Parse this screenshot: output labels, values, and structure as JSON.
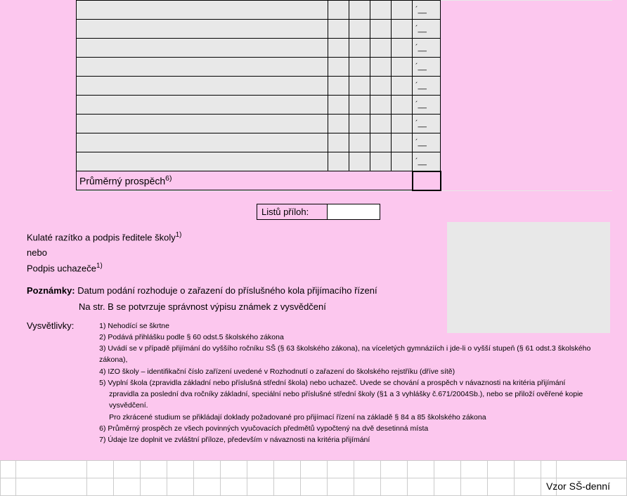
{
  "grades": {
    "placeholder": "´__",
    "row_count": 9,
    "average_label": "Průměrný prospěch",
    "average_sup": "6)"
  },
  "attachments": {
    "label": "Listů příloh:",
    "value": ""
  },
  "stamp": {
    "line1": "Kulaté razítko a podpis ředitele školy",
    "line1_sup": "1)",
    "line2": "nebo",
    "line3": "Podpis uchazeče",
    "line3_sup": "1)"
  },
  "notes": {
    "label": "Poznámky:",
    "text1": "Datum podání rozhoduje o zařazení do příslušného kola přijímacího řízení",
    "text2": "Na str. B se potvrzuje správnost výpisu známek z vysvědčení"
  },
  "explan": {
    "label": "Vysvětlivky:",
    "items": [
      "1) Nehodící se škrtne",
      "2) Podává přihlášku podle § 60 odst.5 školského zákona",
      "3) Uvádí se v případě přijímání do vyššího ročníku SŠ (§ 63 školského zákona), na víceletých gymnáziích i jde-li o vyšší stupeň (§ 61 odst.3 školského zákona),",
      "4) IZO školy – identifikační číslo zařízení uvedené v Rozhodnutí o zařazení do školského rejstříku (dříve sítě)",
      "5) Vyplní škola (zpravidla základní nebo příslušná střední škola) nebo uchazeč. Uvede se chování a prospěch v návaznosti na kritéria přijímání",
      "zpravidla za poslední dva ročníky základní, speciální nebo příslušné střední školy (§1 a 3 vyhlášky č.671/2004Sb.), nebo se přiloží ověřené kopie vysvědčení.",
      "Pro zkrácené studium se přikládají doklady požadované pro přijímací řízení na základě § 84 a 85 školského zákona",
      "6) Průměrný prospěch ze všech povinných vyučovacích předmětů vypočtený na dvě desetinná místa",
      "7) Údaje lze doplnit ve zvláštní příloze, především v návaznosti na kritéria přijímání"
    ],
    "indent_indices": [
      5,
      6
    ]
  },
  "footer": {
    "label": "Vzor SŠ-denní"
  }
}
